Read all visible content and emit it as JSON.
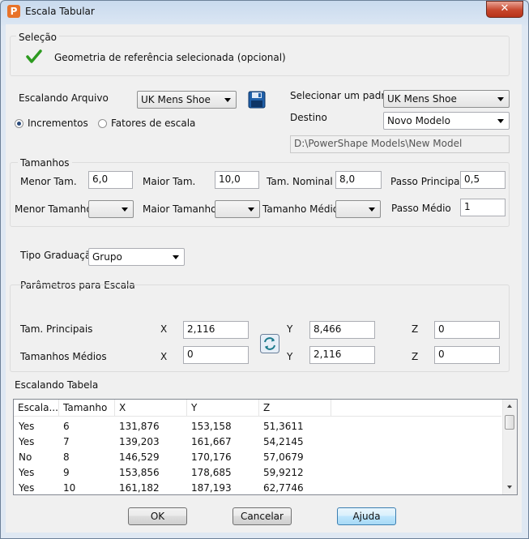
{
  "window": {
    "title": "Escala Tabular",
    "app_icon": "P",
    "close_symbol": "✕"
  },
  "selection": {
    "title": "Seleção",
    "text": "Geometria de referência selecionada (opcional)"
  },
  "file": {
    "label": "Escalando Arquivo",
    "value": "UK Mens Shoe",
    "increments_label": "Incrementos",
    "scale_factors_label": "Fatores de escala",
    "selected_mode": "Incrementos"
  },
  "standard": {
    "label": "Selecionar um padrã",
    "value": "UK Mens Shoe",
    "destination_label": "Destino",
    "destination_value": "Novo Modelo",
    "path": "D:\\PowerShape Models\\New Model"
  },
  "sizes": {
    "title": "Tamanhos",
    "min_label": "Menor Tam.",
    "min_value": "6,0",
    "max_label": "Maior Tam.",
    "max_value": "10,0",
    "nominal_label": "Tam. Nominal",
    "nominal_value": "8,0",
    "main_step_label": "Passo Principal",
    "main_step_value": "0,5",
    "smallest_label": "Menor Tamanho",
    "largest_label": "Maior Tamanho",
    "average_label": "Tamanho Médio",
    "avg_step_label": "Passo Médio",
    "avg_step_value": "1"
  },
  "grading": {
    "label": "Tipo Graduação",
    "value": "Grupo"
  },
  "params": {
    "title": "Parâmetros para Escala",
    "principal_label": "Tam. Principais",
    "medium_label": "Tamanhos Médios",
    "x_label": "X",
    "y_label": "Y",
    "z_label": "Z",
    "principal": {
      "x": "2,116",
      "y": "8,466",
      "z": "0"
    },
    "medium": {
      "x": "0",
      "y": "2,116",
      "z": "0"
    }
  },
  "table": {
    "title": "Escalando Tabela",
    "headers": [
      "Escala...",
      "Tamanho",
      "X",
      "Y",
      "Z"
    ],
    "rows": [
      [
        "Yes",
        "6",
        "131,876",
        "153,158",
        "51,3611"
      ],
      [
        "Yes",
        "7",
        "139,203",
        "161,667",
        "54,2145"
      ],
      [
        "No",
        "8",
        "146,529",
        "170,176",
        "57,0679"
      ],
      [
        "Yes",
        "9",
        "153,856",
        "178,685",
        "59,9212"
      ],
      [
        "Yes",
        "10",
        "161,182",
        "187,193",
        "62,7746"
      ]
    ]
  },
  "buttons": {
    "ok": "OK",
    "cancel": "Cancelar",
    "help": "Ajuda"
  },
  "colors": {
    "check": "#2c9a1f",
    "default_button": "#3c7fb1",
    "save_icon": "#1f5fa8"
  }
}
